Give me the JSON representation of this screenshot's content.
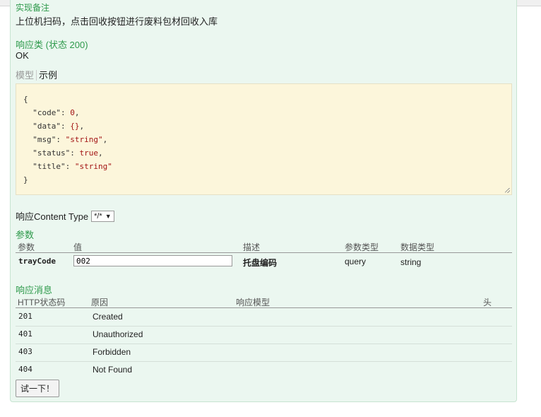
{
  "implementation_notes": {
    "heading": "实现备注",
    "text": "上位机扫码，点击回收按钮进行废料包材回收入库"
  },
  "response_class": {
    "heading": "响应类 (状态 200)",
    "value": "OK",
    "tab_model": "模型",
    "tab_example": "示例",
    "example_lines": [
      {
        "pre": "{",
        "key": "",
        "sep": "",
        "val": "",
        "post": ""
      },
      {
        "pre": "  ",
        "key": "\"code\"",
        "sep": ": ",
        "val": "0",
        "post": ","
      },
      {
        "pre": "  ",
        "key": "\"data\"",
        "sep": ": ",
        "val": "{}",
        "post": ","
      },
      {
        "pre": "  ",
        "key": "\"msg\"",
        "sep": ": ",
        "val": "\"string\"",
        "post": ","
      },
      {
        "pre": "  ",
        "key": "\"status\"",
        "sep": ": ",
        "val": "true",
        "post": ","
      },
      {
        "pre": "  ",
        "key": "\"title\"",
        "sep": ": ",
        "val": "\"string\"",
        "post": ""
      },
      {
        "pre": "}",
        "key": "",
        "sep": "",
        "val": "",
        "post": ""
      }
    ]
  },
  "content_type": {
    "label": "响应Content Type",
    "selected": "*/*"
  },
  "parameters": {
    "heading": "参数",
    "columns": [
      "参数",
      "值",
      "描述",
      "参数类型",
      "数据类型"
    ],
    "rows": [
      {
        "name": "trayCode",
        "value": "002",
        "description": "托盘编码",
        "param_type": "query",
        "data_type": "string"
      }
    ]
  },
  "response_messages": {
    "heading": "响应消息",
    "columns": [
      "HTTP状态码",
      "原因",
      "响应模型",
      "头"
    ],
    "rows": [
      {
        "code": "201",
        "reason": "Created"
      },
      {
        "code": "401",
        "reason": "Unauthorized"
      },
      {
        "code": "403",
        "reason": "Forbidden"
      },
      {
        "code": "404",
        "reason": "Not Found"
      }
    ]
  },
  "try_button": "试一下！",
  "colors": {
    "panel_bg": "#ebf7f0",
    "heading_green": "#2e9a4b",
    "code_bg": "#fcf6db"
  }
}
